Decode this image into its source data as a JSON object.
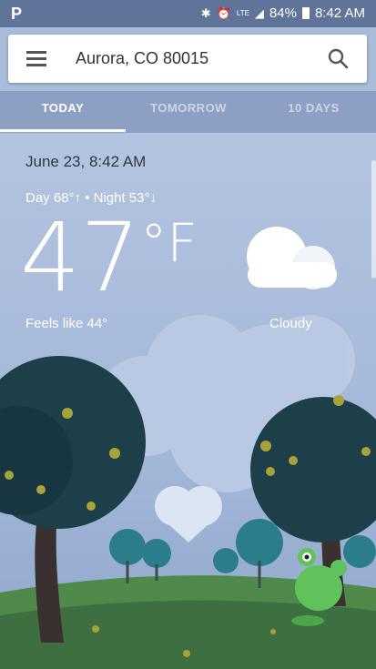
{
  "status_bar": {
    "app_icon": "P",
    "battery_percent": "84%",
    "time": "8:42 AM",
    "lte_label": "LTE",
    "icons": [
      "bluetooth-icon",
      "alarm-icon",
      "signal-icon",
      "battery-icon"
    ]
  },
  "search": {
    "location": "Aurora, CO 80015",
    "menu_icon": "menu-icon",
    "search_icon": "search-icon"
  },
  "tabs": [
    {
      "label": "TODAY",
      "active": true
    },
    {
      "label": "TOMORROW",
      "active": false
    },
    {
      "label": "10 DAYS",
      "active": false
    }
  ],
  "weather": {
    "date": "June 23, 8:42 AM",
    "day_night": "Day 68°↑ • Night 53°↓",
    "temperature": "47",
    "unit": "°F",
    "feels_like": "Feels like 44°",
    "condition": "Cloudy",
    "condition_icon": "cloud-icon"
  },
  "colors": {
    "status_bar": "#5f7498",
    "tabs_bg": "#8da0c4",
    "sky": "#a9bcd9"
  }
}
